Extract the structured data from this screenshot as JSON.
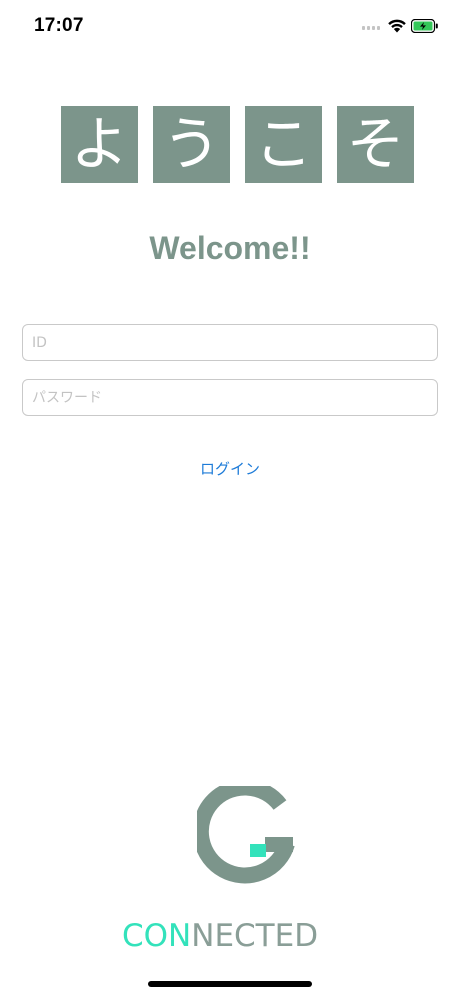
{
  "status_bar": {
    "time": "17:07",
    "icons": [
      "cellular-signal-icon",
      "wifi-icon",
      "battery-charging-icon"
    ]
  },
  "header": {
    "tiles": [
      "よ",
      "う",
      "こ",
      "そ"
    ],
    "welcome": "Welcome!!"
  },
  "form": {
    "id_placeholder": "ID",
    "id_value": "",
    "password_placeholder": "パスワード",
    "password_value": "",
    "login_label": "ログイン"
  },
  "logo": {
    "wordmark_part_a": "CON",
    "wordmark_part_b": "NECTED"
  },
  "colors": {
    "accent": "#7c958b",
    "link": "#1d7bd8",
    "logo_highlight": "#33e2bb",
    "battery": "#34c759"
  }
}
